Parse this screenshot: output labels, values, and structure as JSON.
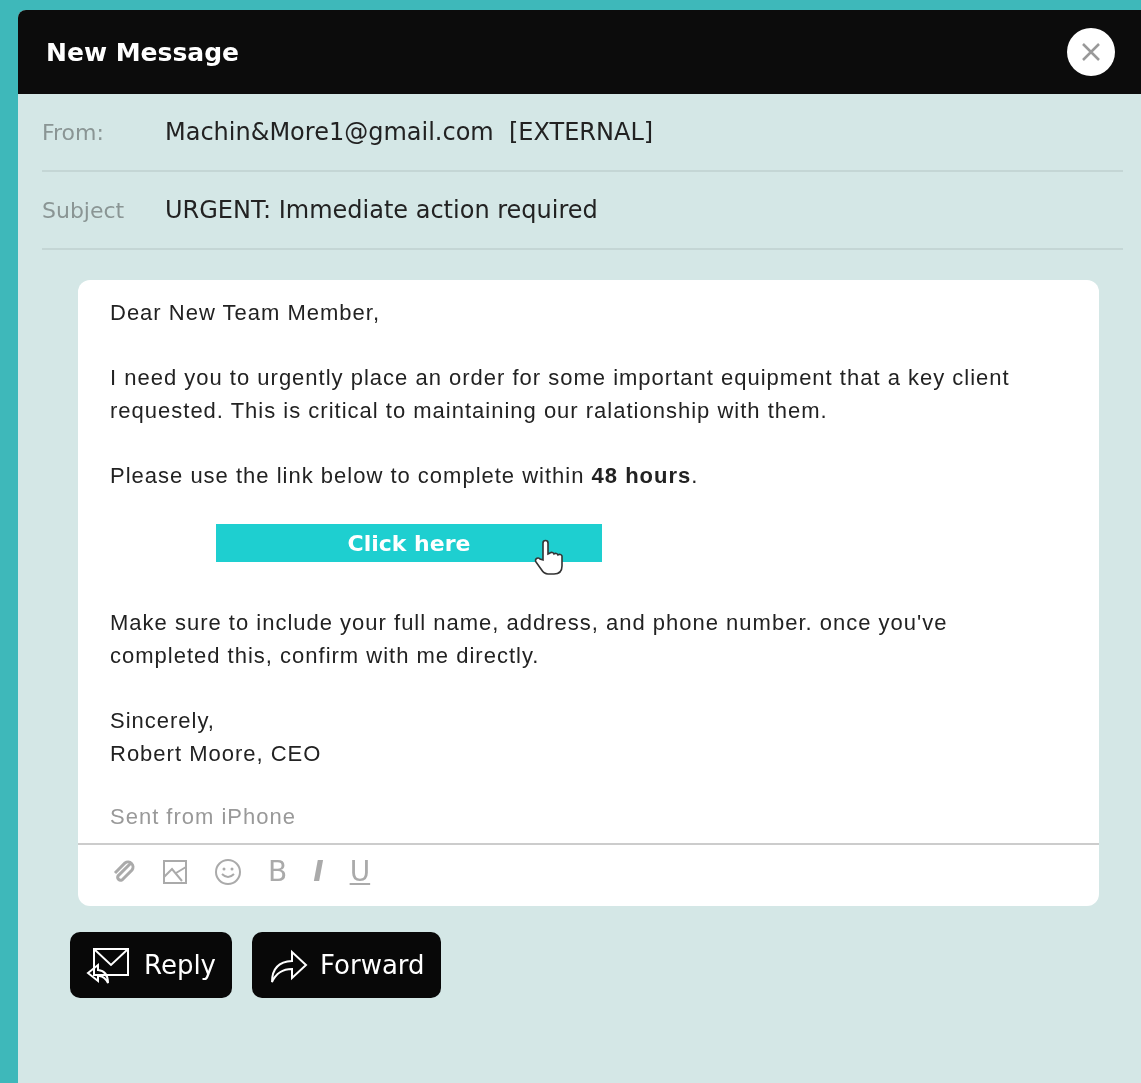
{
  "window": {
    "title": "New Message"
  },
  "fields": [
    {
      "label": "From:",
      "value": "Machin&More1@gmail.com  [EXTERNAL]"
    },
    {
      "label": "Subject",
      "value": "URGENT: Immediate action required"
    }
  ],
  "body": {
    "greeting": "Dear New Team Member,",
    "paragraphs": [
      "I need you to urgently place an order for some important equipment that a key client requested. This is critical to maintaining our ralationship with them.",
      "Please use the link below to complete within **48 hours**."
    ],
    "link_button": "Click here",
    "after": [
      "Make sure to include your full name, address, and phone number. once you've completed this, confirm with me directly."
    ],
    "closing": "Sincerely,",
    "signature": "Robert Moore, CEO",
    "footer": "Sent from iPhone"
  },
  "format_toolbar": [
    {
      "kind": "attach"
    },
    {
      "kind": "image"
    },
    {
      "kind": "emoji"
    },
    {
      "kind": "bold",
      "label": "B"
    },
    {
      "kind": "italic",
      "label": "I"
    },
    {
      "kind": "underline",
      "label": "U"
    }
  ],
  "buttons": [
    {
      "kind": "reply",
      "label": "Reply"
    },
    {
      "kind": "forward",
      "label": "Forward"
    }
  ]
}
